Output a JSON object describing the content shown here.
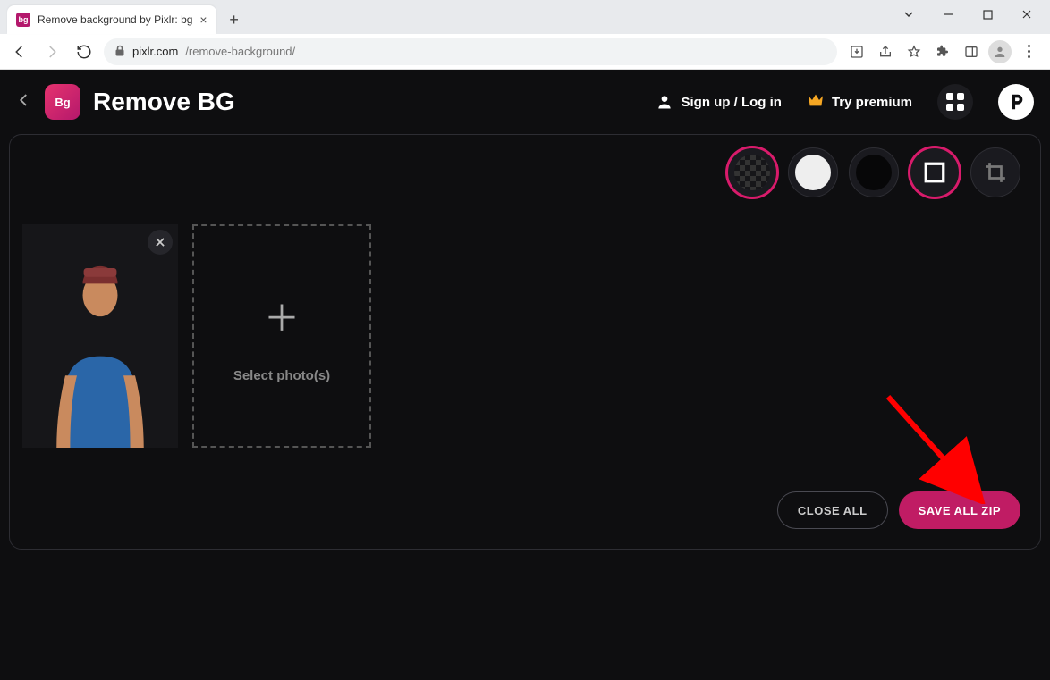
{
  "browser": {
    "tab_title": "Remove background by Pixlr: bg",
    "url_host": "pixlr.com",
    "url_path": "/remove-background/"
  },
  "header": {
    "app_title": "Remove BG",
    "logo_text": "Bg",
    "signup_link": "Sign up / Log in",
    "premium_link": "Try premium"
  },
  "toolbar": {
    "options": [
      "transparent",
      "white",
      "black",
      "outline",
      "crop"
    ],
    "selected": [
      "transparent",
      "outline"
    ]
  },
  "dropzone": {
    "label": "Select photo(s)"
  },
  "actions": {
    "close_all": "CLOSE ALL",
    "save_all": "SAVE ALL ZIP"
  }
}
